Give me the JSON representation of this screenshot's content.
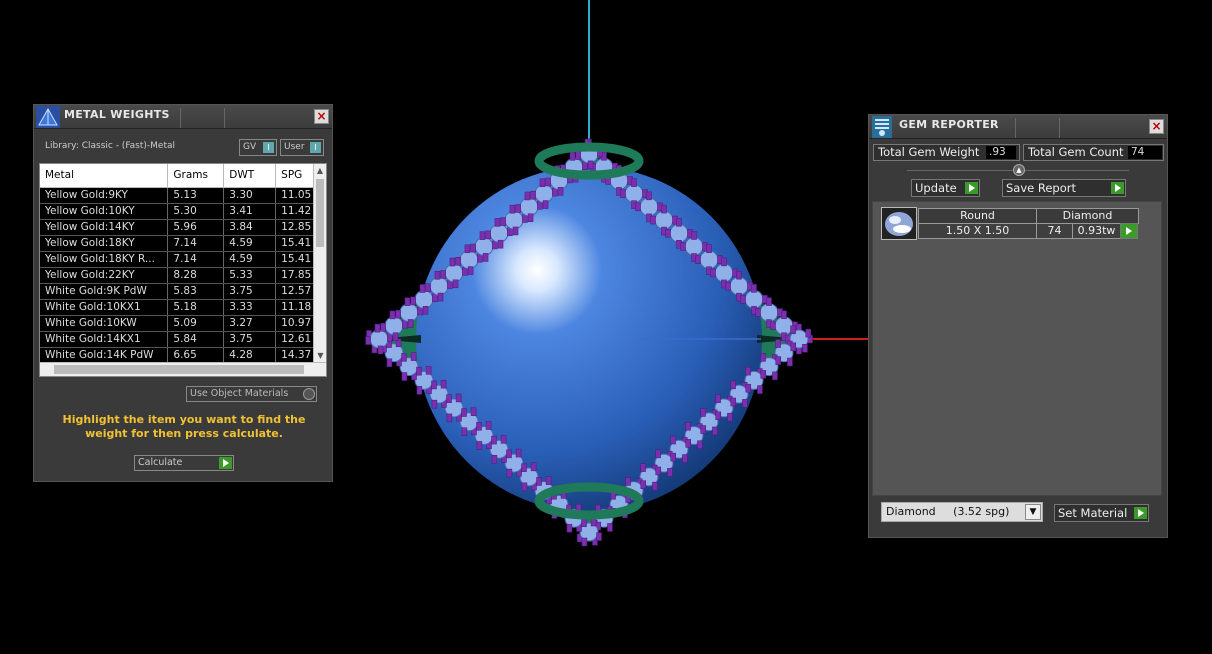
{
  "viewport": {
    "axis_colors": {
      "y": "#2ab0c8",
      "x": "#cc1f1f",
      "blue_line": "#3a6ad0"
    },
    "sphere_color": "#2f6fd6",
    "prong_color": "#7a2fb0",
    "bezel_color": "#1f7a5a"
  },
  "metal_panel": {
    "title": "METAL WEIGHTS",
    "library_label": "Library: Classic - (Fast)-Metal",
    "gv_toggle": "GV",
    "user_toggle": "User",
    "columns": [
      "Metal",
      "Grams",
      "DWT",
      "SPG"
    ],
    "rows": [
      [
        "Yellow Gold:9KY",
        "5.13",
        "3.30",
        "11.05"
      ],
      [
        "Yellow Gold:10KY",
        "5.30",
        "3.41",
        "11.42"
      ],
      [
        "Yellow Gold:14KY",
        "5.96",
        "3.84",
        "12.85"
      ],
      [
        "Yellow Gold:18KY",
        "7.14",
        "4.59",
        "15.41"
      ],
      [
        "Yellow Gold:18KY R...",
        "7.14",
        "4.59",
        "15.41"
      ],
      [
        "Yellow Gold:22KY",
        "8.28",
        "5.33",
        "17.85"
      ],
      [
        "White Gold:9K PdW",
        "5.83",
        "3.75",
        "12.57"
      ],
      [
        "White Gold:10KX1",
        "5.18",
        "3.33",
        "11.18"
      ],
      [
        "White Gold:10KW",
        "5.09",
        "3.27",
        "10.97"
      ],
      [
        "White Gold:14KX1",
        "5.84",
        "3.75",
        "12.61"
      ],
      [
        "White Gold:14K PdW",
        "6.65",
        "4.28",
        "14.37"
      ]
    ],
    "use_object_materials": "Use Object Materials",
    "hint": "Highlight the item you want to find the weight for then press calculate.",
    "calculate_label": "Calculate"
  },
  "gem_panel": {
    "title": "GEM REPORTER",
    "total_weight_label": "Total Gem Weight",
    "total_weight_value": ".93",
    "total_count_label": "Total Gem Count",
    "total_count_value": "74",
    "update_label": "Update",
    "save_report_label": "Save Report",
    "gem_row": {
      "shape": "Round",
      "material": "Diamond",
      "size": "1.50 X 1.50",
      "count": "74",
      "weight": "0.93tw"
    },
    "material_select": "Diamond     (3.52 spg)",
    "set_material_label": "Set Material"
  }
}
